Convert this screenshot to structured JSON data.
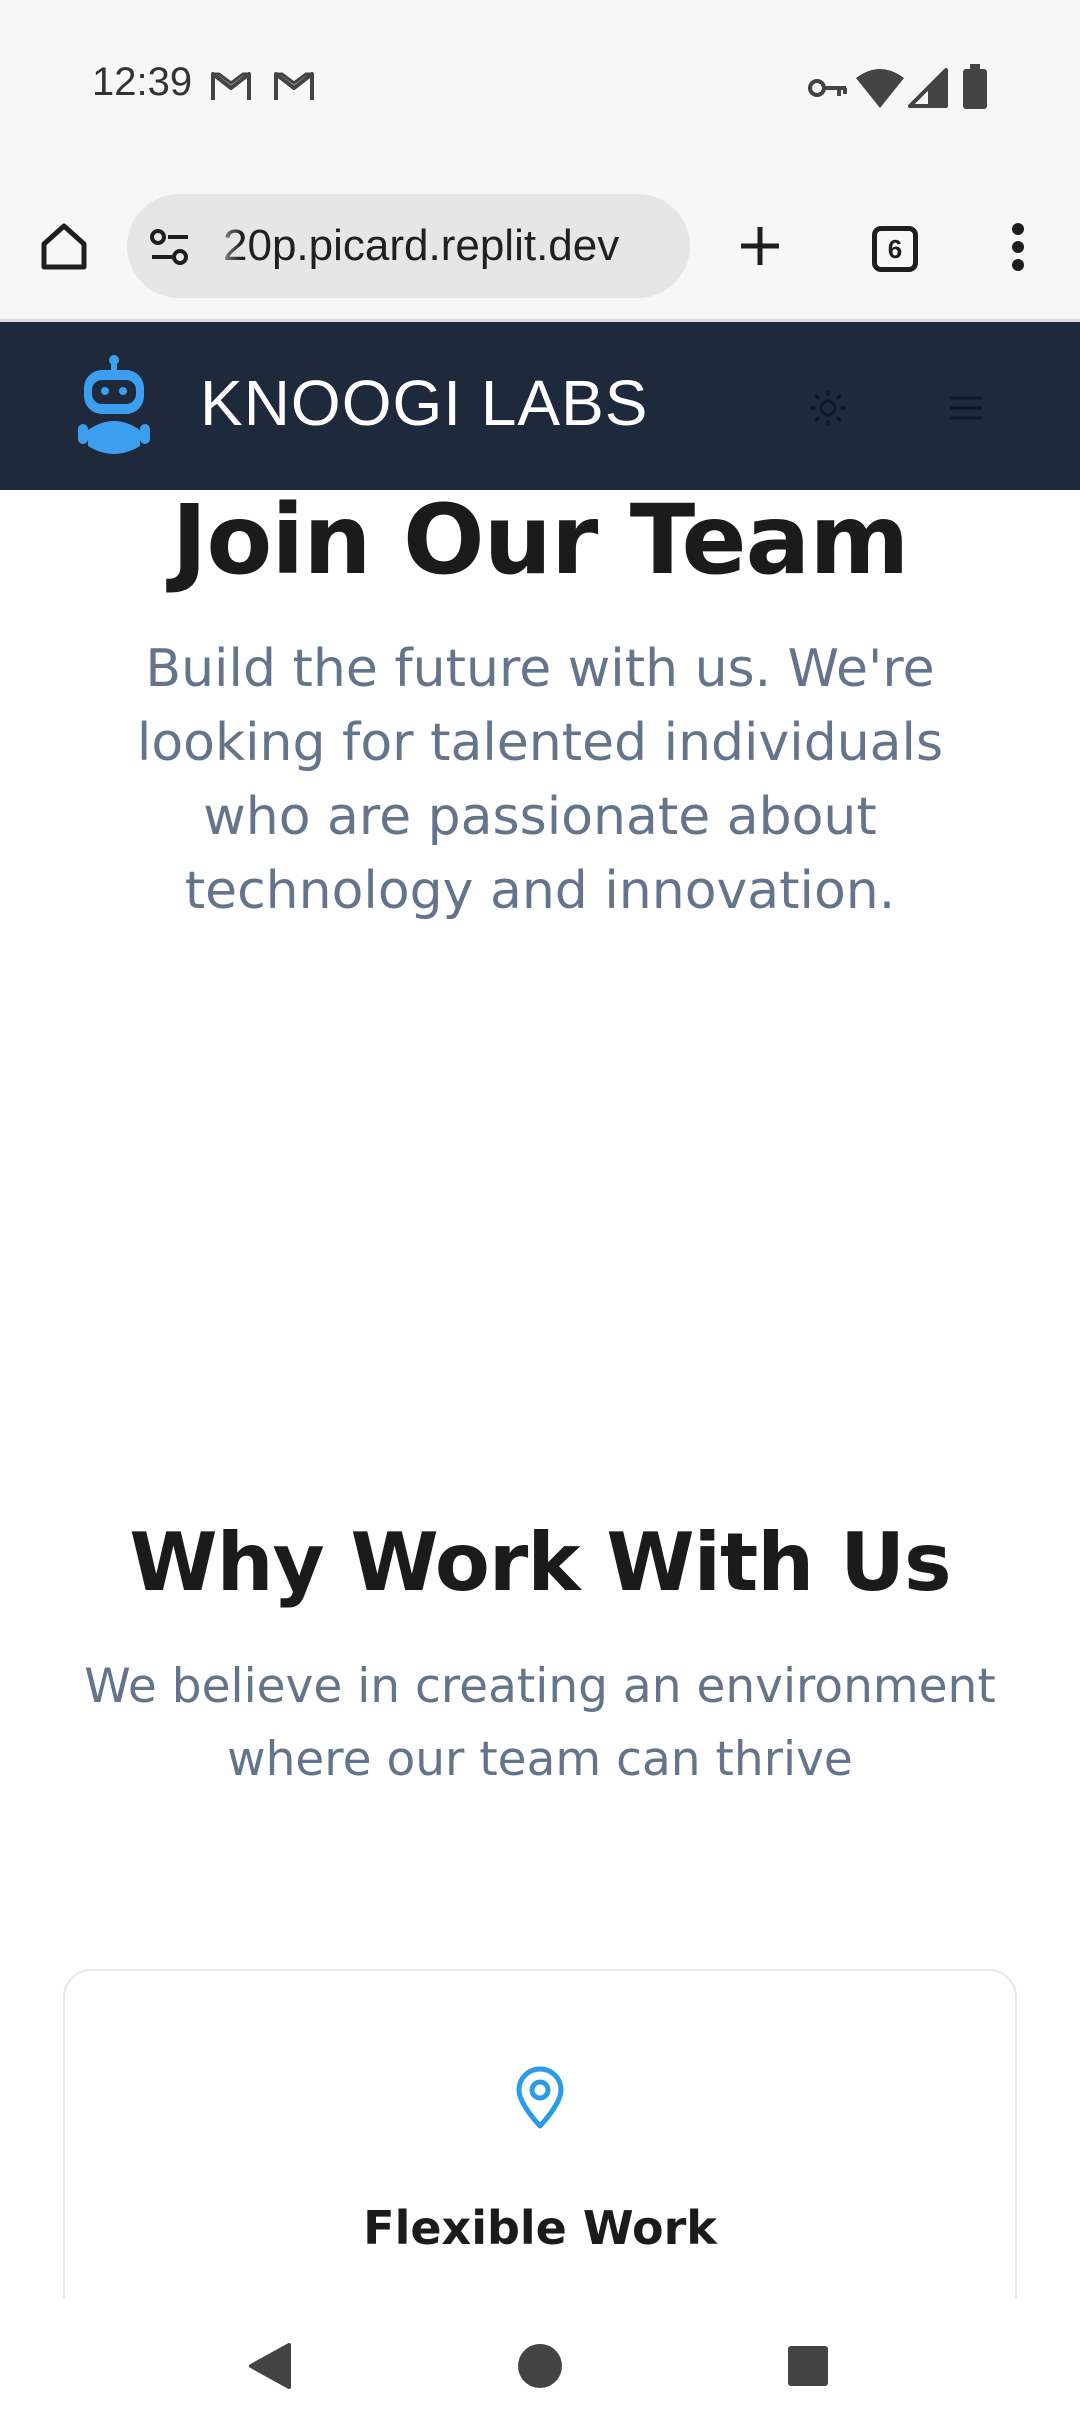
{
  "status_bar": {
    "time": "12:39",
    "left_icons": [
      "gmail-icon",
      "gmail-icon"
    ],
    "right_icons": [
      "vpn-key-icon",
      "wifi-icon",
      "signal-icon",
      "battery-icon"
    ]
  },
  "browser": {
    "url": "20p.picard.replit.dev",
    "tab_count": "6",
    "icons": [
      "home-icon",
      "site-settings-icon",
      "new-tab-icon",
      "tab-switcher-icon",
      "more-vert-icon"
    ]
  },
  "header": {
    "brand": "KNOOGI LABS",
    "icons": [
      "robot-logo-icon",
      "sun-icon",
      "hamburger-menu-icon"
    ],
    "background": "#1e293b",
    "accent": "#3b9eee"
  },
  "hero": {
    "title": "Join Our Team",
    "subtitle": "Build the future with us. We're looking for talented individuals who are passionate about technology and innovation."
  },
  "why": {
    "title": "Why Work With Us",
    "subtitle": "We believe in creating an environment where our team can thrive"
  },
  "features": [
    {
      "icon": "map-pin-icon",
      "title": "Flexible Work"
    }
  ],
  "nav": {
    "icons": [
      "back-icon",
      "home-circle-icon",
      "recents-icon"
    ]
  }
}
